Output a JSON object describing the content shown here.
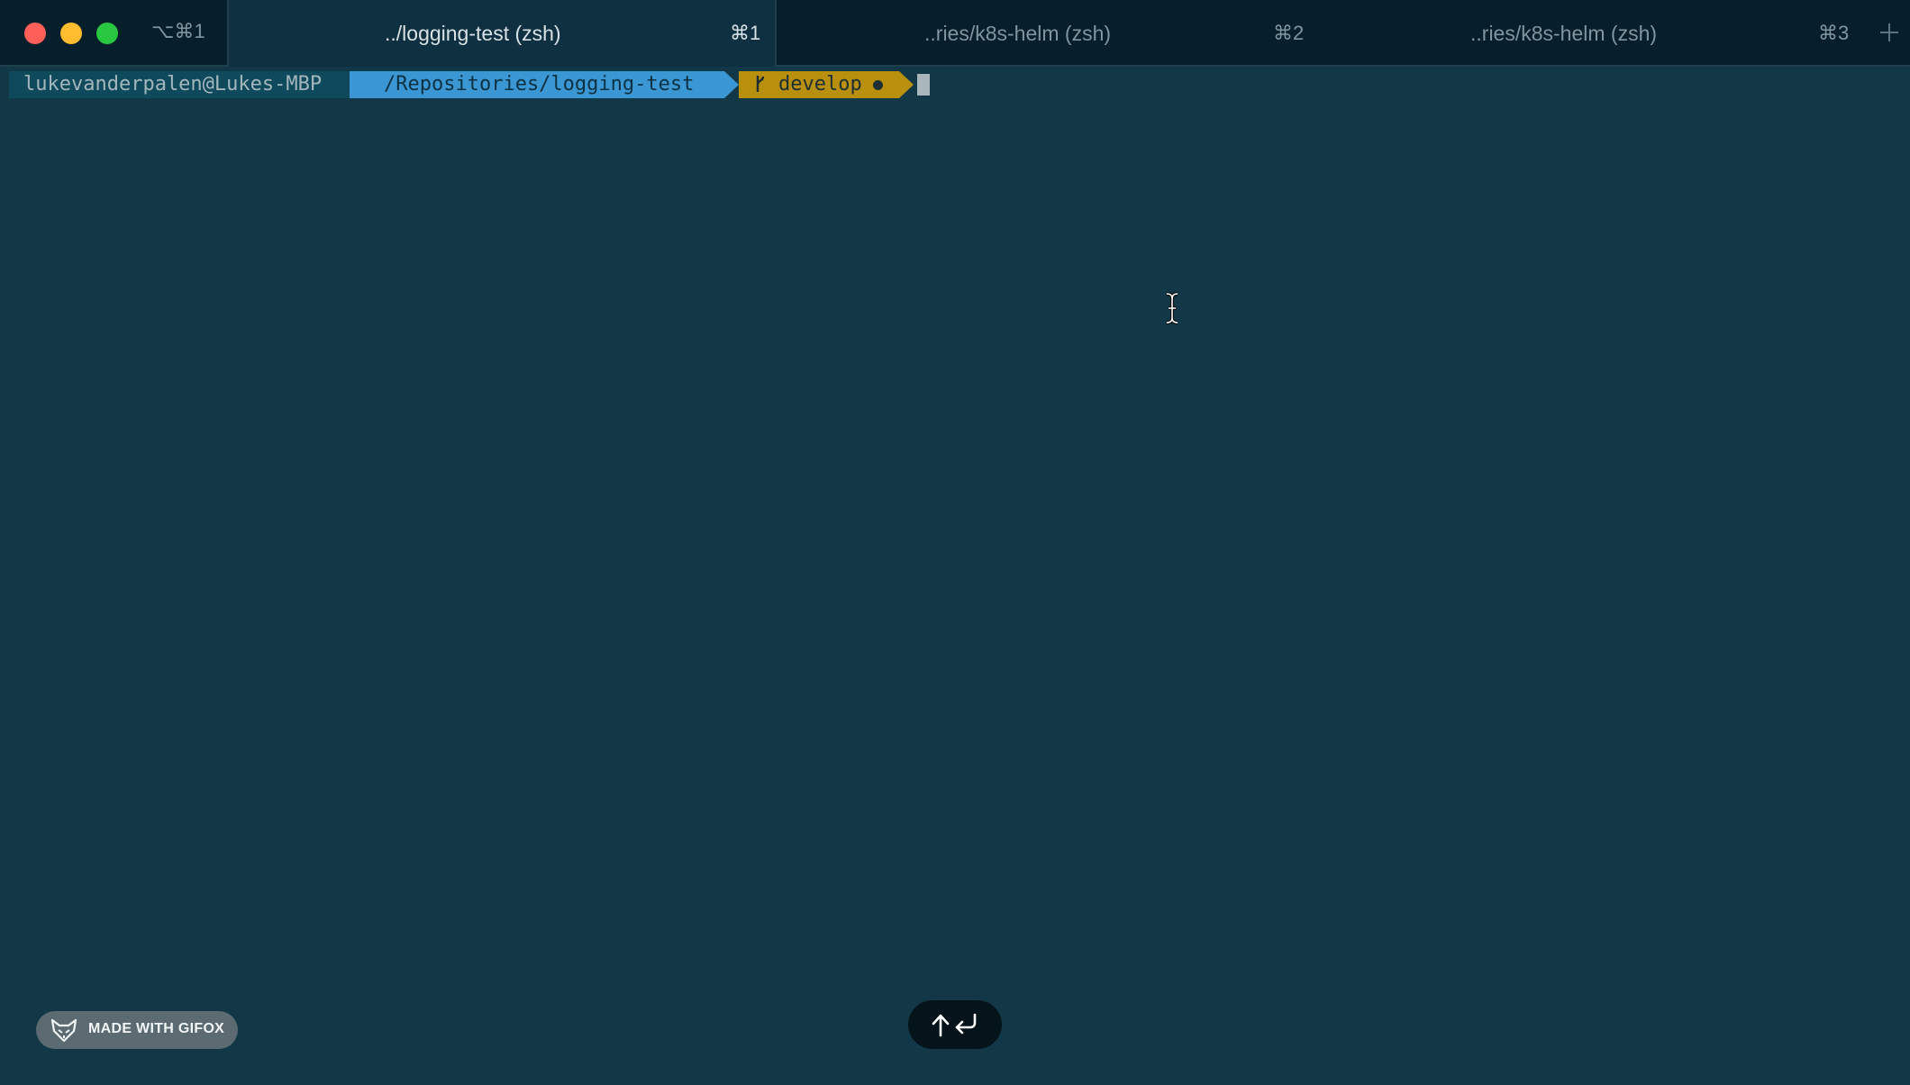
{
  "window": {
    "shortcut": "⌥⌘1"
  },
  "tabs": [
    {
      "title": "../logging-test (zsh)",
      "shortcut": "⌘1",
      "active": true
    },
    {
      "title": "..ries/k8s-helm (zsh)",
      "shortcut": "⌘2",
      "active": false
    },
    {
      "title": "..ries/k8s-helm (zsh)",
      "shortcut": "⌘3",
      "active": false
    }
  ],
  "new_tab": {
    "icon": "plus-icon"
  },
  "prompt": {
    "user_host": "lukevanderpalen@Lukes-MBP",
    "path": "/Repositories/logging-test",
    "branch_icon": "git-branch-icon",
    "branch": "develop",
    "dirty_indicator": "dirty-dot-icon"
  },
  "badges": {
    "gifox": "MADE WITH GIFOX",
    "key_hint_icons": [
      "arrow-up-icon",
      "return-icon"
    ]
  },
  "colors": {
    "background": "#123847",
    "tabbar": "#061f2b",
    "segment_user": "#0f4a5c",
    "segment_path": "#3a97d3",
    "segment_git": "#b9900e"
  }
}
